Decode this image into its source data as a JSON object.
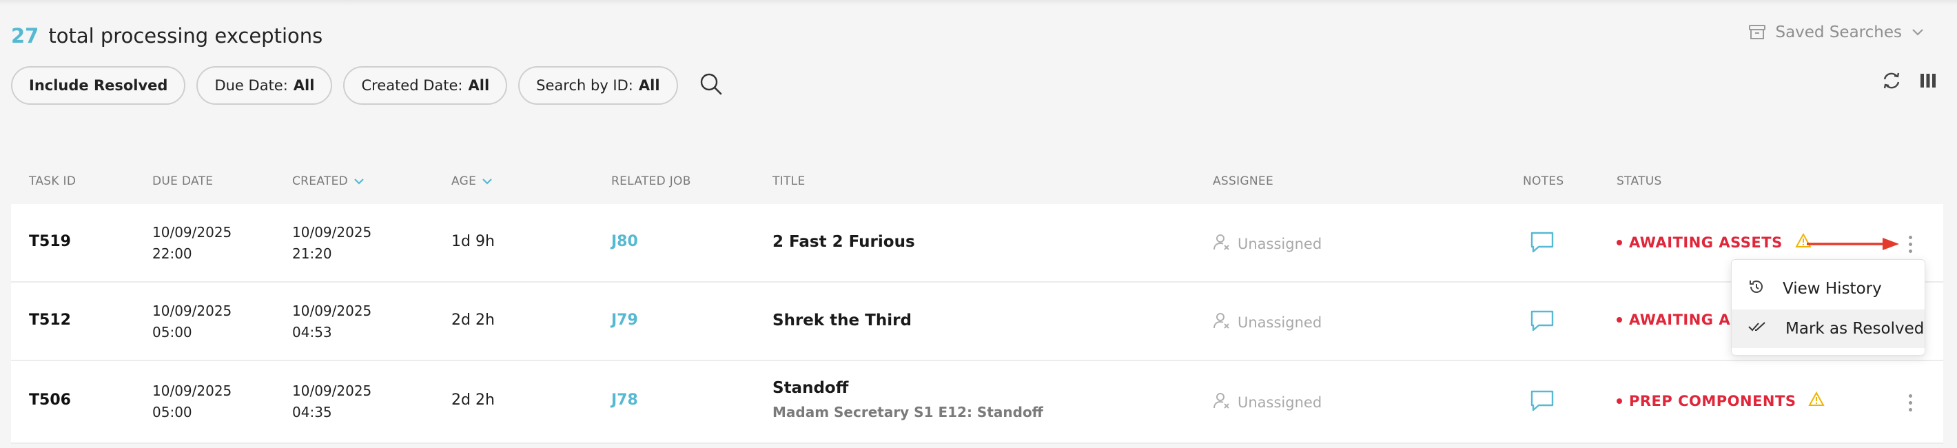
{
  "header": {
    "count": "27",
    "title": "total processing exceptions"
  },
  "saved_searches": {
    "label": "Saved Searches"
  },
  "filters": {
    "include_resolved": "Include Resolved",
    "due_date": {
      "key": "Due Date:",
      "value": "All"
    },
    "created_date": {
      "key": "Created Date:",
      "value": "All"
    },
    "search_by_id": {
      "key": "Search by ID:",
      "value": "All"
    }
  },
  "columns": {
    "task_id": "TASK ID",
    "due_date": "DUE DATE",
    "created": "CREATED",
    "age": "AGE",
    "related_job": "RELATED JOB",
    "title": "TITLE",
    "assignee": "ASSIGNEE",
    "notes": "NOTES",
    "status": "STATUS"
  },
  "rows": [
    {
      "task_id": "T519",
      "due_date": "10/09/2025",
      "due_time": "22:00",
      "created_date": "10/09/2025",
      "created_time": "21:20",
      "age": "1d 9h",
      "job": "J80",
      "title": "2 Fast 2 Furious",
      "subtitle": "",
      "assignee": "Unassigned",
      "status": "AWAITING ASSETS"
    },
    {
      "task_id": "T512",
      "due_date": "10/09/2025",
      "due_time": "05:00",
      "created_date": "10/09/2025",
      "created_time": "04:53",
      "age": "2d 2h",
      "job": "J79",
      "title": "Shrek the Third",
      "subtitle": "",
      "assignee": "Unassigned",
      "status": "AWAITING ASS"
    },
    {
      "task_id": "T506",
      "due_date": "10/09/2025",
      "due_time": "05:00",
      "created_date": "10/09/2025",
      "created_time": "04:35",
      "age": "2d 2h",
      "job": "J78",
      "title": "Standoff",
      "subtitle": "Madam Secretary S1 E12: Standoff",
      "assignee": "Unassigned",
      "status": "PREP COMPONENTS"
    }
  ],
  "context_menu": {
    "view_history": "View History",
    "mark_resolved": "Mark as Resolved"
  },
  "colors": {
    "accent": "#55b9d2",
    "status_red": "#e0263a",
    "warning": "#f0b400"
  }
}
